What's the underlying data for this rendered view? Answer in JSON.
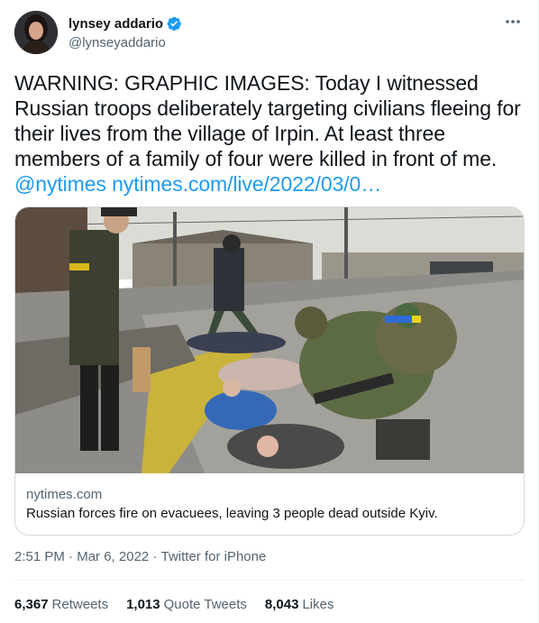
{
  "author": {
    "display_name": "lynsey addario",
    "handle": "@lynseyaddario",
    "verified": true
  },
  "tweet": {
    "text_main": "WARNING: GRAPHIC IMAGES: Today I witnessed Russian troops deliberately targeting civilians fleeing for their lives from the village of Irpin. At least three members of a family of four were killed in front of me.",
    "mention": "@nytimes",
    "link": "nytimes.com/live/2022/03/0…"
  },
  "card": {
    "domain": "nytimes.com",
    "title": "Russian forces fire on evacuees, leaving 3 people dead outside Kyiv."
  },
  "meta": {
    "time": "2:51 PM",
    "separator": " · ",
    "date": "Mar 6, 2022",
    "source": "Twitter for iPhone"
  },
  "stats": {
    "retweets_count": "6,367",
    "retweets_label": "Retweets",
    "quotes_count": "1,013",
    "quotes_label": "Quote Tweets",
    "likes_count": "8,043",
    "likes_label": "Likes"
  },
  "icons": {
    "verified": "verified-badge-icon",
    "more": "more-icon"
  },
  "colors": {
    "link": "#1d9bf0",
    "secondary": "#536471",
    "text": "#0f1419"
  }
}
